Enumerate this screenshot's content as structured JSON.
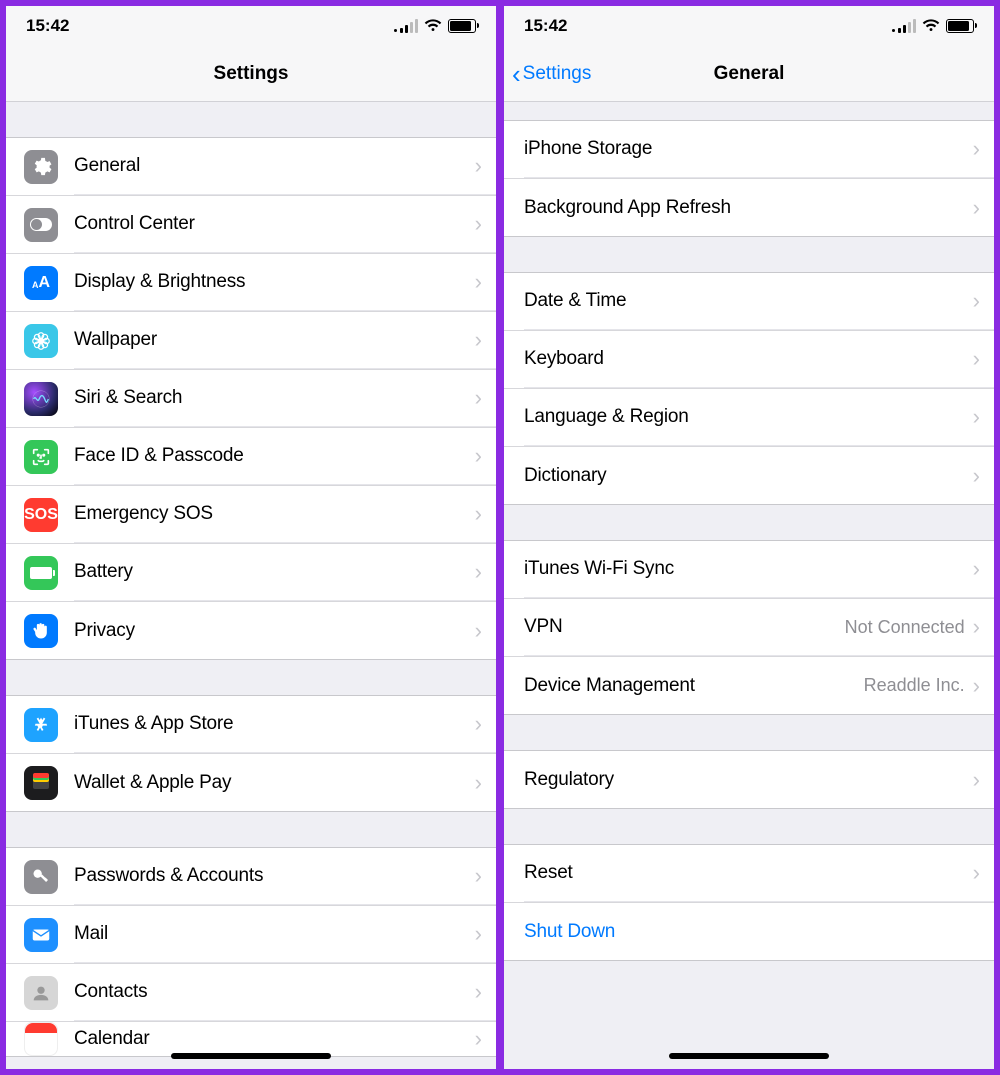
{
  "status": {
    "time": "15:42"
  },
  "left": {
    "title": "Settings",
    "groups": [
      {
        "items": [
          {
            "label": "General"
          },
          {
            "label": "Control Center"
          },
          {
            "label": "Display & Brightness"
          },
          {
            "label": "Wallpaper"
          },
          {
            "label": "Siri & Search"
          },
          {
            "label": "Face ID & Passcode"
          },
          {
            "label": "Emergency SOS"
          },
          {
            "label": "Battery"
          },
          {
            "label": "Privacy"
          }
        ]
      },
      {
        "items": [
          {
            "label": "iTunes & App Store"
          },
          {
            "label": "Wallet & Apple Pay"
          }
        ]
      },
      {
        "items": [
          {
            "label": "Passwords & Accounts"
          },
          {
            "label": "Mail"
          },
          {
            "label": "Contacts"
          },
          {
            "label": "Calendar"
          }
        ]
      }
    ]
  },
  "right": {
    "back": "Settings",
    "title": "General",
    "groups": [
      {
        "items": [
          {
            "label": "iPhone Storage"
          },
          {
            "label": "Background App Refresh"
          }
        ]
      },
      {
        "items": [
          {
            "label": "Date & Time"
          },
          {
            "label": "Keyboard"
          },
          {
            "label": "Language & Region"
          },
          {
            "label": "Dictionary"
          }
        ]
      },
      {
        "items": [
          {
            "label": "iTunes Wi-Fi Sync"
          },
          {
            "label": "VPN",
            "detail": "Not Connected"
          },
          {
            "label": "Device Management",
            "detail": "Readdle Inc."
          }
        ]
      },
      {
        "items": [
          {
            "label": "Regulatory"
          }
        ]
      },
      {
        "items": [
          {
            "label": "Reset"
          },
          {
            "label": "Shut Down",
            "link": true,
            "nochev": true
          }
        ]
      }
    ]
  }
}
